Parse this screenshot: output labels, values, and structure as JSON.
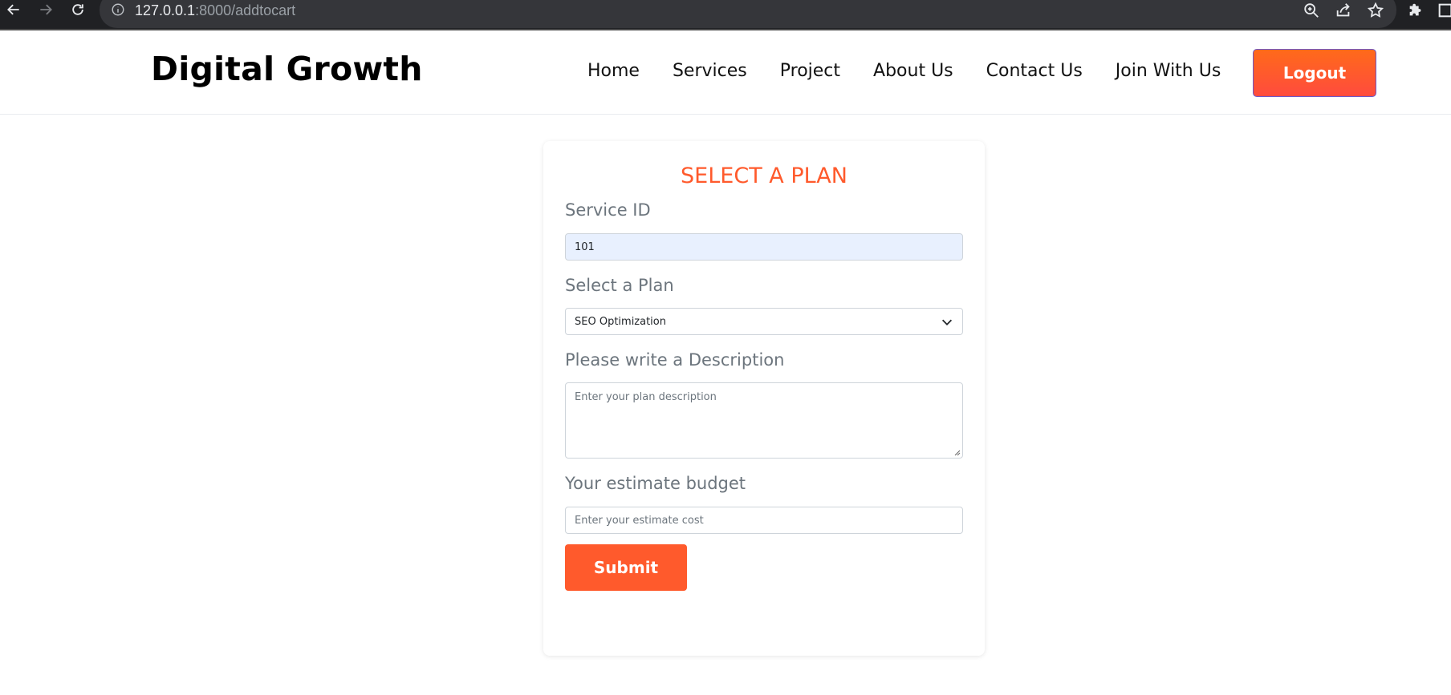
{
  "browser": {
    "url_host": "127.0.0.1",
    "url_rest": ":8000/addtocart",
    "icons": [
      "back-arrow-icon",
      "forward-arrow-icon",
      "reload-icon",
      "info-icon",
      "zoom-icon",
      "share-icon",
      "bookmark-star-icon",
      "extensions-puzzle-icon",
      "window-icon"
    ]
  },
  "header": {
    "brand": "Digital Growth",
    "nav": [
      {
        "label": "Home"
      },
      {
        "label": "Services"
      },
      {
        "label": "Project"
      },
      {
        "label": "About Us"
      },
      {
        "label": "Contact Us"
      },
      {
        "label": "Join With Us"
      }
    ],
    "logout_label": "Logout"
  },
  "form": {
    "title": "SELECT A PLAN",
    "service_id": {
      "label": "Service ID",
      "value": "101"
    },
    "plan": {
      "label": "Select a Plan",
      "selected": "SEO Optimization"
    },
    "description": {
      "label": "Please write a Description",
      "placeholder": "Enter your plan description"
    },
    "budget": {
      "label": "Your estimate budget",
      "placeholder": "Enter your estimate cost"
    },
    "submit_label": "Submit"
  },
  "colors": {
    "accent": "#ff5a2c",
    "logout_gradient_top": "#ff6a1a",
    "logout_gradient_bottom": "#ff4b3e",
    "browser_bar": "#202124",
    "autofill_bg": "#e8f0fe"
  }
}
